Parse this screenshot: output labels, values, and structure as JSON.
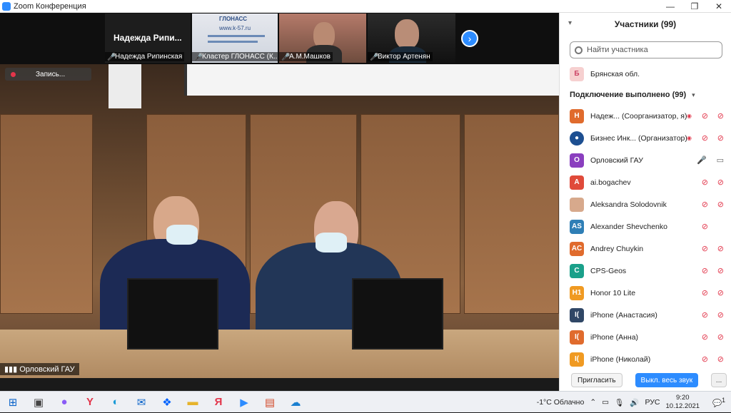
{
  "window": {
    "title": "Zoom Конференция"
  },
  "thumbnails": [
    {
      "name": "Надежда Рипинская",
      "big_label": "Надежда  Рипи..."
    },
    {
      "name": "Кластер ГЛОНАСС (К...",
      "slide_title": "ГЛОНАСС",
      "slide_url": "www.k-57.ru"
    },
    {
      "name": "А.М.Машков"
    },
    {
      "name": "Виктор Артенян"
    }
  ],
  "main_video": {
    "recording_label": "Запись...",
    "speaker_name": "Орловский ГАУ"
  },
  "panel": {
    "title": "Участники (99)",
    "search_placeholder": "Найти участника",
    "first_row": {
      "initial": "Б",
      "name": "Брянская обл.",
      "color": "#f6d0d0"
    },
    "section": "Подключение выполнено (99)",
    "participants": [
      {
        "initial": "Н",
        "name": "Надеж...  (Соорганизатор, я)",
        "color": "#e06b2d"
      },
      {
        "initial": "●",
        "name": "Бизнес Инк...  (Организатор)",
        "color": "#1d4f91"
      },
      {
        "initial": "О",
        "name": "Орловский ГАУ",
        "color": "#8a3fbf"
      },
      {
        "initial": "A",
        "name": "ai.bogachev",
        "color": "#e04a3a"
      },
      {
        "initial": "",
        "name": "Aleksandra Solodovnik",
        "color": "#d7a98c"
      },
      {
        "initial": "AS",
        "name": "Alexander Shevchenko",
        "color": "#2f7fb6"
      },
      {
        "initial": "AC",
        "name": "Andrey Chuykin",
        "color": "#e06b2d"
      },
      {
        "initial": "C",
        "name": "CPS-Geos",
        "color": "#1aa08a"
      },
      {
        "initial": "H1",
        "name": "Honor 10 Lite",
        "color": "#f09a22"
      },
      {
        "initial": "I(",
        "name": "iPhone (Анастасия)",
        "color": "#304766"
      },
      {
        "initial": "I(",
        "name": "iPhone (Анна)",
        "color": "#e06b2d"
      },
      {
        "initial": "I(",
        "name": "iPhone (Николай)",
        "color": "#f09a22"
      }
    ],
    "invite_label": "Пригласить",
    "mute_all_label": "Выкл. весь звук",
    "more_label": "..."
  },
  "taskbar": {
    "weather": "-1°C  Облачно",
    "lang": "РУС",
    "time": "9:20",
    "date": "10.12.2021",
    "notif_count": "1"
  }
}
